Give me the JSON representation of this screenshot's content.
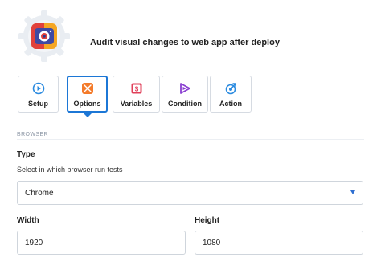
{
  "header": {
    "title": "Audit visual changes to web app after deploy",
    "app_icon": "camera-app-icon",
    "colors": {
      "tile_left": "#e1413c",
      "tile_right": "#f5a623",
      "lens": "#2b3990",
      "gear": "#e9edf2"
    }
  },
  "steps": [
    {
      "label": "Setup",
      "icon": "play-circle-icon",
      "color": "#2b8be0"
    },
    {
      "label": "Options",
      "icon": "options-icon",
      "color": "#f47b2b",
      "active": true
    },
    {
      "label": "Variables",
      "icon": "variables-icon",
      "color": "#e0405a"
    },
    {
      "label": "Condition",
      "icon": "condition-icon",
      "color": "#8a3fd1"
    },
    {
      "label": "Action",
      "icon": "action-icon",
      "color": "#2b8be0"
    }
  ],
  "section": {
    "label": "BROWSER"
  },
  "type_field": {
    "label": "Type",
    "description": "Select in which browser run tests",
    "value": "Chrome"
  },
  "width_field": {
    "label": "Width",
    "value": "1920"
  },
  "height_field": {
    "label": "Height",
    "value": "1080"
  },
  "accent_color": "#1c77d6"
}
